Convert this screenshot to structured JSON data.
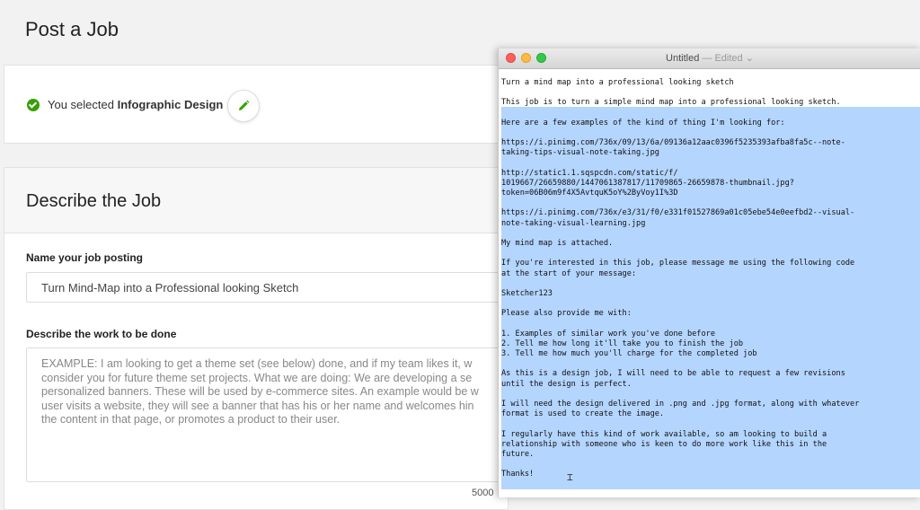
{
  "page": {
    "title": "Post a Job"
  },
  "selection": {
    "prefix": "You selected",
    "category": "Infographic Design"
  },
  "describe": {
    "title": "Describe the Job",
    "name_label": "Name your job posting",
    "name_value": "Turn Mind-Map into a Professional looking Sketch",
    "work_label": "Describe the work to be done",
    "work_placeholder": "EXAMPLE: I am looking to get a theme set (see below) done, and if my team likes it, w\nconsider you for future theme set projects. What we are doing: We are developing a se\npersonalized banners. These will be used by e-commerce sites. An example would be w\nuser visits a website, they will see a banner that has his or her name and welcomes hin\nthe content in that page, or promotes a product to their user.",
    "char_count": "5000"
  },
  "editor_window": {
    "title": "Untitled",
    "status": "— Edited ⌄",
    "lines": [
      "Turn a mind map into a professional looking sketch",
      "",
      "This job is to turn a simple mind map into a professional looking sketch.",
      "",
      "Here are a few examples of the kind of thing I'm looking for:",
      "",
      "https://i.pinimg.com/736x/09/13/6a/09136a12aac0396f5235393afba8fa5c--note-",
      "taking-tips-visual-note-taking.jpg",
      "",
      "http://static1.1.sqspcdn.com/static/f/",
      "1019667/26659880/1447061387817/11709865-26659878-thumbnail.jpg?",
      "token=06B06m9f4X5AvtquK5oY%2ByVoy1I%3D",
      "",
      "https://i.pinimg.com/736x/e3/31/f0/e331f01527869a01c05ebe54e0eefbd2--visual-",
      "note-taking-visual-learning.jpg",
      "",
      "My mind map is attached.",
      "",
      "If you're interested in this job, please message me using the following code",
      "at the start of your message:",
      "",
      "Sketcher123",
      "",
      "Please also provide me with:",
      "",
      "1. Examples of similar work you've done before",
      "2. Tell me how long it'll take you to finish the job",
      "3. Tell me how much you'll charge for the completed job",
      "",
      "As this is a design job, I will need to be able to request a few revisions",
      "until the design is perfect.",
      "",
      "I will need the design delivered in .png and .jpg format, along with whatever",
      "format is used to create the image.",
      "",
      "I regularly have this kind of work available, so am looking to build a",
      "relationship with someone who is keen to do more work like this in the",
      "future.",
      "",
      "Thanks!"
    ]
  },
  "colors": {
    "accent_green": "#37a000",
    "selection_blue": "#b4d5fe"
  },
  "icons": {
    "check": "check-circle-icon",
    "edit": "pencil-icon",
    "cursor": "text-cursor-icon"
  }
}
